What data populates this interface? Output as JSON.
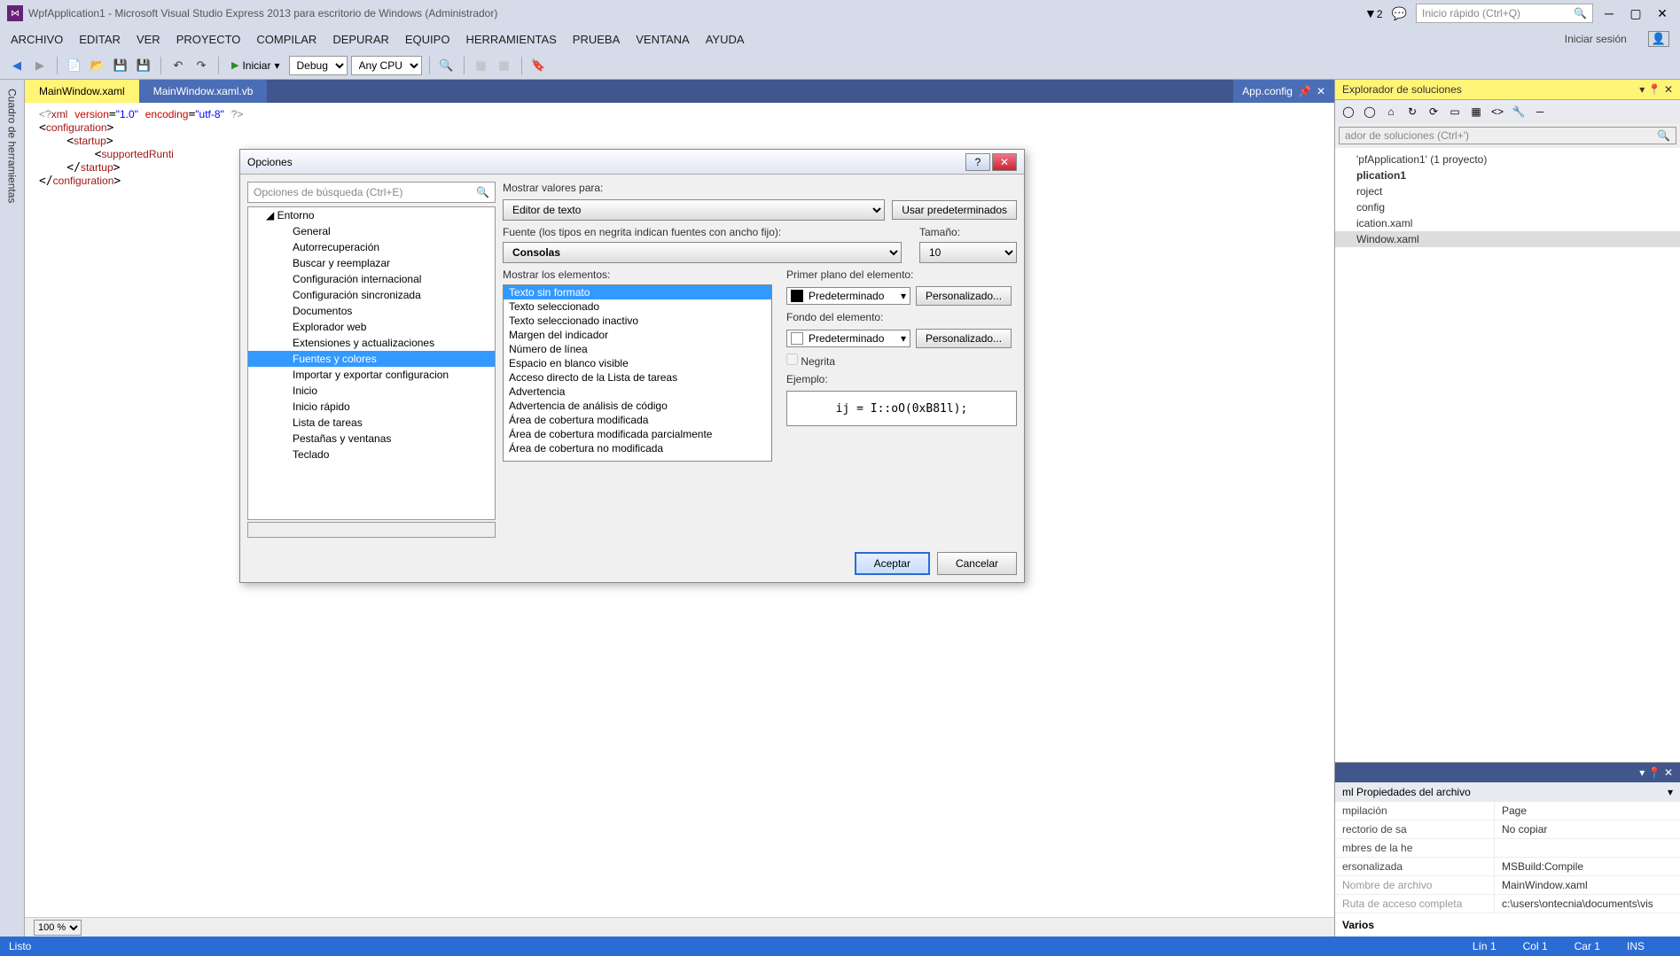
{
  "titlebar": {
    "title": "WpfApplication1 - Microsoft Visual Studio Express 2013 para escritorio de Windows (Administrador)",
    "flag_count": "2",
    "quick_search_placeholder": "Inicio rápido (Ctrl+Q)"
  },
  "menubar": {
    "items": [
      "ARCHIVO",
      "EDITAR",
      "VER",
      "PROYECTO",
      "COMPILAR",
      "DEPURAR",
      "EQUIPO",
      "HERRAMIENTAS",
      "PRUEBA",
      "VENTANA",
      "AYUDA"
    ],
    "login": "Iniciar sesión"
  },
  "toolbar": {
    "start_label": "Iniciar",
    "config": "Debug",
    "platform": "Any CPU"
  },
  "left_sidebar": {
    "label": "Cuadro de herramientas"
  },
  "tabs": {
    "active": "MainWindow.xaml",
    "inactive": "MainWindow.xaml.vb",
    "right": "App.config"
  },
  "code_lines": [
    "<?xml version=\"1.0\" encoding=\"utf-8\" ?>",
    "<configuration>",
    "    <startup>",
    "        <supportedRunti",
    "    </startup>",
    "</configuration>"
  ],
  "zoom": "100 %",
  "solution_explorer": {
    "title": "Explorador de soluciones",
    "search_placeholder": "ador de soluciones (Ctrl+')",
    "nodes": [
      "'pfApplication1' (1 proyecto)",
      "plication1",
      "roject",
      "config",
      "ication.xaml",
      "Window.xaml"
    ]
  },
  "properties_panel": {
    "sub": "ml  Propiedades del archivo",
    "rows": [
      {
        "k": "mpilación",
        "v": "Page",
        "gray": false
      },
      {
        "k": "rectorio de sa",
        "v": "No copiar",
        "gray": false
      },
      {
        "k": "mbres de la he",
        "v": "",
        "gray": false
      },
      {
        "k": "ersonalizada",
        "v": "MSBuild:Compile",
        "gray": false
      },
      {
        "k": "Nombre de archivo",
        "v": "MainWindow.xaml",
        "gray": true
      },
      {
        "k": "Ruta de acceso completa",
        "v": "c:\\users\\ontecnia\\documents\\vis",
        "gray": true
      }
    ],
    "category": "Varios"
  },
  "dialog": {
    "title": "Opciones",
    "search_placeholder": "Opciones de búsqueda (Ctrl+E)",
    "tree": {
      "category": "Entorno",
      "items": [
        "General",
        "Autorrecuperación",
        "Buscar y reemplazar",
        "Configuración internacional",
        "Configuración sincronizada",
        "Documentos",
        "Explorador web",
        "Extensiones y actualizaciones",
        "Fuentes y colores",
        "Importar y exportar configuracion",
        "Inicio",
        "Inicio rápido",
        "Lista de tareas",
        "Pestañas y ventanas",
        "Teclado"
      ],
      "selected": "Fuentes y colores"
    },
    "labels": {
      "show_settings_for": "Mostrar valores para:",
      "use_defaults": "Usar predeterminados",
      "font": "Fuente (los tipos en negrita indican fuentes con ancho fijo):",
      "size": "Tamaño:",
      "display_items": "Mostrar los elementos:",
      "item_foreground": "Primer plano del elemento:",
      "item_background": "Fondo del elemento:",
      "custom": "Personalizado...",
      "bold": "Negrita",
      "example": "Ejemplo:",
      "default_color": "Predeterminado"
    },
    "show_settings_value": "Editor de texto",
    "font_value": "Consolas",
    "size_value": "10",
    "display_items": [
      "Texto sin formato",
      "Texto seleccionado",
      "Texto seleccionado inactivo",
      "Margen del indicador",
      "Número de línea",
      "Espacio en blanco visible",
      "Acceso directo de la Lista de tareas",
      "Advertencia",
      "Advertencia de análisis de código",
      "Área de cobertura modificada",
      "Área de cobertura modificada parcialmente",
      "Área de cobertura no modificada"
    ],
    "display_selected": "Texto sin formato",
    "example_text": "ij = I::oO(0xB81l);",
    "buttons": {
      "ok": "Aceptar",
      "cancel": "Cancelar"
    }
  },
  "statusbar": {
    "ready": "Listo",
    "line": "Lín 1",
    "col": "Col 1",
    "car": "Car 1",
    "ins": "INS"
  }
}
